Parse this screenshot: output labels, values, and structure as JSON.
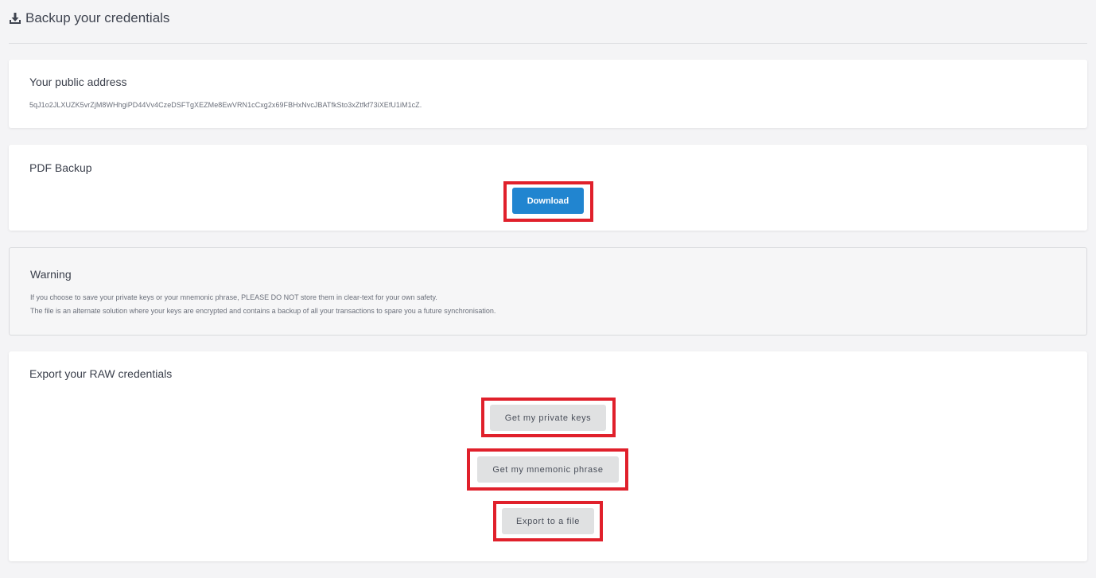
{
  "header": {
    "icon": "download-icon",
    "title": "Backup your credentials"
  },
  "public_address": {
    "title": "Your public address",
    "value": "5qJ1o2JLXUZK5vrZjM8WHhgiPD44Vv4CzeDSFTgXEZMe8EwVRN1cCxg2x69FBHxNvcJBATfkSto3xZtfkf73iXEfU1iM1cZ."
  },
  "pdf_backup": {
    "title": "PDF Backup",
    "download_label": "Download"
  },
  "warning": {
    "title": "Warning",
    "line1": "If you choose to save your private keys or your mnemonic phrase, PLEASE DO NOT store them in clear-text for your own safety.",
    "line2": "The file is an alternate solution where your keys are encrypted and contains a backup of all your transactions to spare you a future synchronisation."
  },
  "raw_export": {
    "title": "Export your RAW credentials",
    "private_keys_label": "Get my private keys",
    "mnemonic_label": "Get my mnemonic phrase",
    "export_file_label": "Export to a file"
  },
  "colors": {
    "primary": "#2185d0",
    "highlight": "#e0202b",
    "background": "#f4f4f6"
  }
}
